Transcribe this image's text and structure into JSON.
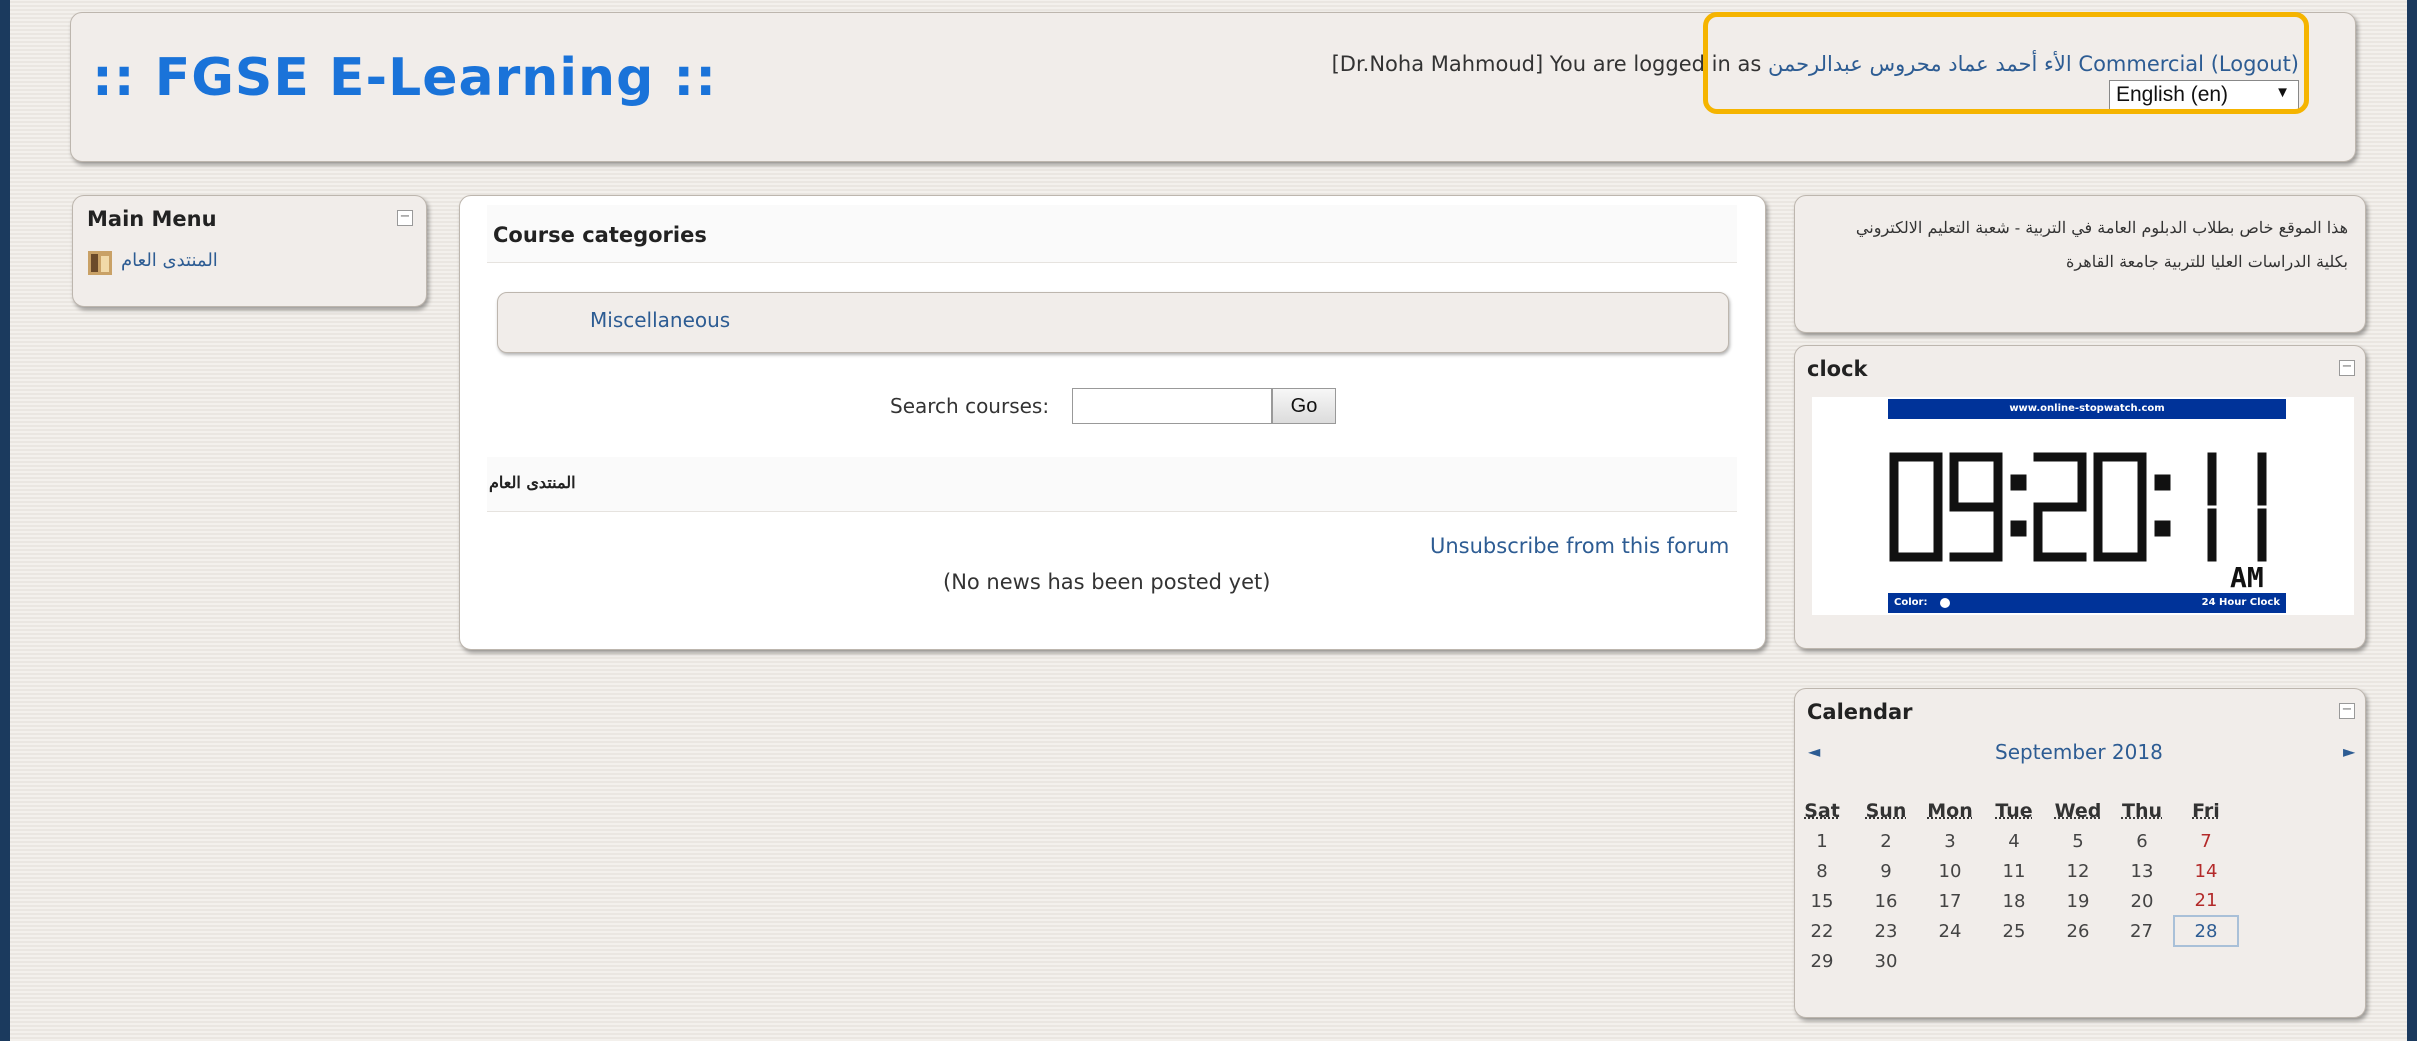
{
  "header": {
    "site_title": ":: FGSE E-Learning ::",
    "login_prefix": "[Dr.Noha Mahmoud] You are logged in as ",
    "login_user": "الأء أحمد عماد محروس عبدالرحمن Commercial",
    "logout_label": "(Logout)",
    "language_selected": "English (en)"
  },
  "main_menu": {
    "title": "Main Menu",
    "items": [
      {
        "label": "المنتدى العام"
      }
    ]
  },
  "center": {
    "course_categories_title": "Course categories",
    "categories": [
      {
        "label": "Miscellaneous"
      }
    ],
    "search_label": "Search courses:",
    "search_value": "",
    "go_label": "Go",
    "forum_title": "المنتدى العام",
    "unsubscribe_label": "Unsubscribe from this forum",
    "no_news": "(No news has been posted yet)"
  },
  "info_block": {
    "text_line1": "هذا الموقع خاص بطلاب الدبلوم العامة في التربية - شعبة التعليم الالكتروني",
    "text_line2": "بكلية الدراسات العليا للتربية جامعة القاهرة"
  },
  "clock": {
    "title": "clock",
    "site": "www.online-stopwatch.com",
    "time": "09:20:11",
    "ampm": "AM",
    "color_label": "Color:",
    "mode_label": "24 Hour Clock"
  },
  "calendar": {
    "title": "Calendar",
    "month": "September 2018",
    "prev": "◄",
    "next": "►",
    "weekdays": [
      "Sat",
      "Sun",
      "Mon",
      "Tue",
      "Wed",
      "Thu",
      "Fri"
    ],
    "weeks": [
      [
        "1",
        "2",
        "3",
        "4",
        "5",
        "6",
        "7"
      ],
      [
        "8",
        "9",
        "10",
        "11",
        "12",
        "13",
        "14"
      ],
      [
        "15",
        "16",
        "17",
        "18",
        "19",
        "20",
        "21"
      ],
      [
        "22",
        "23",
        "24",
        "25",
        "26",
        "27",
        "28"
      ],
      [
        "29",
        "30",
        "",
        "",
        "",
        "",
        ""
      ]
    ],
    "today": "28"
  },
  "colors": {
    "title_blue": "#1a73d9",
    "link_blue": "#2d5c93",
    "clock_banner": "#003399",
    "highlight": "#f5b400"
  }
}
